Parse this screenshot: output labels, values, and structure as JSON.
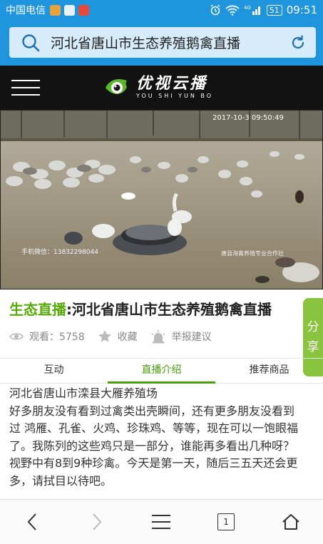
{
  "status_bar": {
    "carrier": "中国电信",
    "network": "4G",
    "battery": "51",
    "time": "09:51"
  },
  "search": {
    "query": "河北省唐山市生态养殖鹅禽直播",
    "icon": "search-icon",
    "refresh_icon": "refresh-icon"
  },
  "header": {
    "logo_cn": "优视云播",
    "logo_en": "YOU SHI YUN BO"
  },
  "video": {
    "timestamp": "2017-10-3  09:50:49",
    "watermark_left": "手机微信：13832298044",
    "watermark_right": "唐县海禽养殖专业合作社"
  },
  "title": {
    "tag": "生态直播",
    "separator": ":",
    "text": "河北省唐山市生态养殖鹅禽直播"
  },
  "stats": {
    "views_label": "观看：5758",
    "favorite_label": "收藏",
    "report_label": "举报建议"
  },
  "share": {
    "label_1": "分",
    "label_2": "享"
  },
  "tabs": [
    {
      "label": "互动",
      "active": false
    },
    {
      "label": "直播介绍",
      "active": true
    },
    {
      "label": "推荐商品",
      "active": false
    }
  ],
  "content": {
    "lines": [
      "河北省唐山市滦县大雁养殖场",
      "好多朋友没有看到过禽类出壳瞬间，还有更多朋友没看到",
      "过 鸿雁、孔雀、火鸡、珍珠鸡、等等，现在可以一饱眼福",
      "了。我陈列的这些鸡只是一部分，谁能再多看出几种呀？",
      "视野中有8到9种珍禽。今天是第一天，随后三五天还会更",
      "多，请拭目以待吧。"
    ]
  },
  "bottom_nav": {
    "tab_count": "1"
  },
  "colors": {
    "primary_blue": "#1f95de",
    "accent_green": "#58a90a",
    "share_green": "#8ac33e"
  }
}
